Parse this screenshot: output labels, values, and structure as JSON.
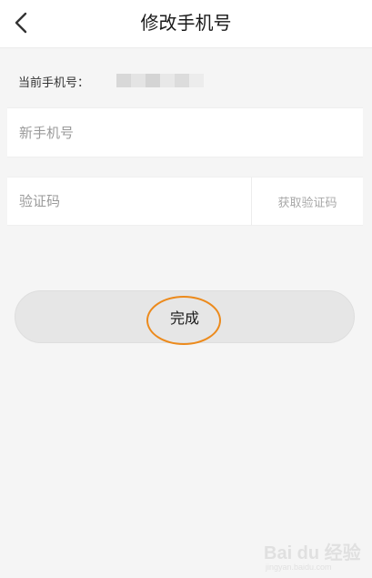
{
  "header": {
    "title": "修改手机号",
    "back_icon": "chevron-left-icon"
  },
  "current_phone": {
    "label": "当前手机号：",
    "value_masked": true
  },
  "new_phone": {
    "placeholder": "新手机号",
    "value": ""
  },
  "verification": {
    "placeholder": "验证码",
    "value": "",
    "get_code_label": "获取验证码"
  },
  "submit": {
    "label": "完成"
  },
  "watermark": {
    "text": "Bai du 经验",
    "sub": "jingyan.baidu.com"
  },
  "colors": {
    "accent_ellipse": "#ec8a1c",
    "page_background": "#f5f5f5",
    "button_background": "#e6e6e6"
  }
}
